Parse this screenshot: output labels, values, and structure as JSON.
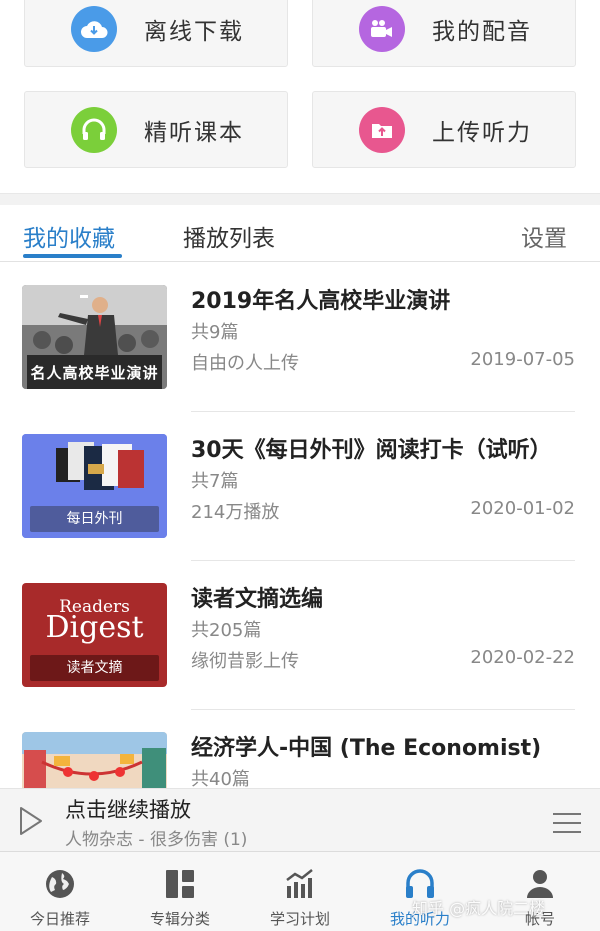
{
  "quick_cards": [
    {
      "label": "离线下载",
      "icon": "cloud-download-icon",
      "color": "#4a9be8"
    },
    {
      "label": "我的配音",
      "icon": "video-camera-icon",
      "color": "#b566e0"
    },
    {
      "label": "精听课本",
      "icon": "headphones-icon",
      "color": "#7bcf3a"
    },
    {
      "label": "上传听力",
      "icon": "upload-folder-icon",
      "color": "#e8578f"
    }
  ],
  "tabs": {
    "favorites": "我的收藏",
    "playlist": "播放列表",
    "settings": "设置"
  },
  "items": [
    {
      "title": "2019年名人高校毕业演讲",
      "count": "共9篇",
      "source": "自由の人上传",
      "date": "2019-07-05",
      "thumb_text": "名人高校毕业演讲"
    },
    {
      "title": "30天《每日外刊》阅读打卡（试听）",
      "count": "共7篇",
      "source": "214万播放",
      "date": "2020-01-02",
      "thumb_text": "每日外刊"
    },
    {
      "title": "读者文摘选编",
      "count": "共205篇",
      "source": "缘彻昔影上传",
      "date": "2020-02-22",
      "thumb_text": "读者文摘",
      "thumb_brand_1": "Readers",
      "thumb_brand_2": "Digest"
    },
    {
      "title": "经济学人-中国 (The Economist)",
      "count": "共40篇"
    }
  ],
  "player": {
    "title": "点击继续播放",
    "subtitle": "人物杂志 - 很多伤害 (1)"
  },
  "nav": [
    {
      "label": "今日推荐",
      "icon": "globe-icon"
    },
    {
      "label": "专辑分类",
      "icon": "grid-icon"
    },
    {
      "label": "学习计划",
      "icon": "bar-chart-icon"
    },
    {
      "label": "我的听力",
      "icon": "headphones-icon",
      "active": true
    },
    {
      "label": "帐号",
      "icon": "person-icon"
    }
  ],
  "watermark": "知乎 @疯人院二楼",
  "colors": {
    "accent": "#2a7fc9"
  }
}
